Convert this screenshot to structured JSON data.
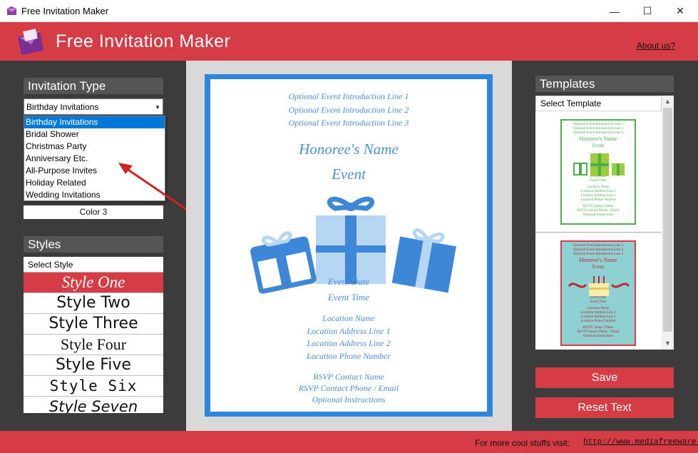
{
  "window": {
    "title": "Free Invitation Maker",
    "minimize_glyph": "—",
    "maximize_glyph": "☐",
    "close_glyph": "✕"
  },
  "header": {
    "app_title": "Free Invitation Maker",
    "about_link": "About us?"
  },
  "invitation_type": {
    "title": "Invitation Type",
    "selected": "Birthday Invitations",
    "options": [
      "Birthday Invitations",
      "Bridal Shower",
      "Christmas Party",
      "Anniversary Etc.",
      "All-Purpose Invites",
      "Holiday Related",
      "Wedding Invitations"
    ],
    "color_label": "Color 3"
  },
  "styles": {
    "title": "Styles",
    "header": "Select Style",
    "items": [
      "Style One",
      "Style Two",
      "Style Three",
      "Style Four",
      "Style Five",
      "Style Six",
      "Style Seven"
    ],
    "active_index": 0
  },
  "invitation": {
    "intro_lines": [
      "Optional Event Introduction Line 1",
      "Optional Event Introduction Line 2",
      "Optional Event Introduction Line 3"
    ],
    "honoree": "Honoree's Name",
    "event": "Event",
    "event_date": "Event Date",
    "event_time": "Event Time",
    "location_lines": [
      "Location Name",
      "Location Address Line 1",
      "Location Address Line 2",
      "Location Phone Number"
    ],
    "rsvp_lines": [
      "RSVP Contact Name",
      "RSVP Contact Phone / Email",
      "Optional Instructions"
    ],
    "accent_color": "#2e87dd"
  },
  "templates": {
    "title": "Templates",
    "header": "Select Template",
    "items": [
      {
        "name": "green-gifts-template",
        "color": "#4cae4c",
        "lines": [
          "Optional Event Introduction Line 1",
          "Optional Event Introduction Line 2",
          "Optional Event Introduction Line 3",
          "Honoree's Name",
          "Event",
          "Event Date",
          "Event Time",
          "Location Name",
          "Location Address Line 1",
          "Location Address Line 2",
          "Location Phone Number",
          "RSVP Contact Name",
          "RSVP Contact Phone / Email",
          "Optional Instructions"
        ]
      },
      {
        "name": "red-cake-template",
        "color": "#d63c45",
        "lines": [
          "Optional Event Introduction Line 1",
          "Optional Event Introduction Line 2",
          "Optional Event Introduction Line 3",
          "Honoree's Name",
          "Event",
          "Event Date",
          "Event Time",
          "Location Name",
          "Location Address Line 1",
          "Location Address Line 2",
          "Location Phone Number",
          "RSVP Contact Name",
          "RSVP Contact Phone / Email",
          "Optional Instructions"
        ]
      }
    ]
  },
  "actions": {
    "save": "Save",
    "reset": "Reset Text"
  },
  "footer": {
    "visit_text": "For more cool stuffs visit:",
    "visit_link": "http://www.mediafreeware.com"
  },
  "colors": {
    "brand_red": "#d63c45",
    "panel_dark": "#3c3c3c",
    "select_blue": "#0078d7"
  }
}
